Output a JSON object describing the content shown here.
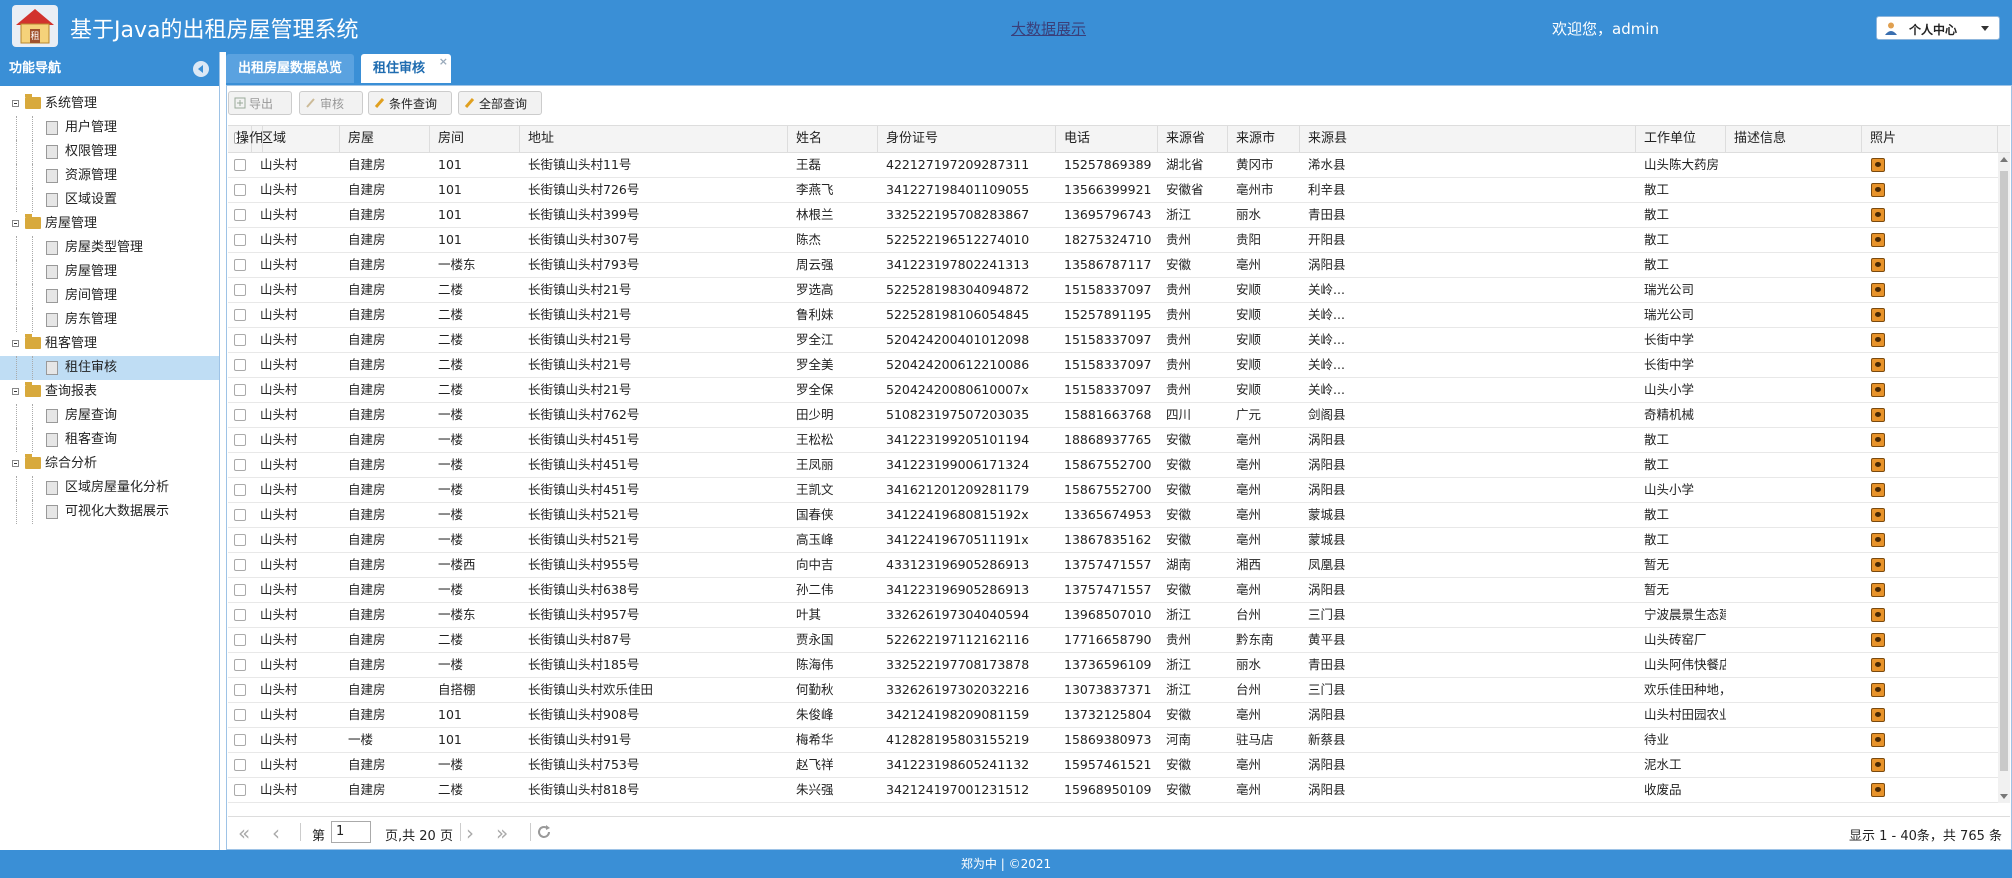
{
  "header": {
    "title": "基于Java的出租房屋管理系统",
    "big_data_link": "大数据展示",
    "welcome": "欢迎您，admin",
    "user_center": "个人中心"
  },
  "sidebar": {
    "title": "功能导航",
    "groups": [
      {
        "label": "系统管理",
        "items": [
          "用户管理",
          "权限管理",
          "资源管理",
          "区域设置"
        ]
      },
      {
        "label": "房屋管理",
        "items": [
          "房屋类型管理",
          "房屋管理",
          "房间管理",
          "房东管理"
        ]
      },
      {
        "label": "租客管理",
        "items": [
          "租住审核"
        ]
      },
      {
        "label": "查询报表",
        "items": [
          "房屋查询",
          "租客查询"
        ]
      },
      {
        "label": "综合分析",
        "items": [
          "区域房屋量化分析",
          "可视化大数据展示"
        ]
      }
    ],
    "selected": "租住审核"
  },
  "tabs": [
    {
      "label": "出租房屋数据总览"
    },
    {
      "label": "租住审核",
      "close": "×"
    }
  ],
  "toolbar": {
    "export": "导出",
    "audit": "审核",
    "condition_query": "条件查询",
    "all_query": "全部查询"
  },
  "table": {
    "columns": [
      "区域",
      "房屋",
      "房间",
      "地址",
      "姓名",
      "身份证号",
      "电话",
      "来源省",
      "来源市",
      "来源县",
      "工作单位",
      "描述信息",
      "照片",
      "操作"
    ],
    "rows": [
      [
        "山头村",
        "自建房",
        "101",
        "长街镇山头村11号",
        "王磊",
        "422127197209287311",
        "15257869389",
        "湖北省",
        "黄冈市",
        "浠水县",
        "山头陈大药房"
      ],
      [
        "山头村",
        "自建房",
        "101",
        "长街镇山头村726号",
        "李燕飞",
        "341227198401109055",
        "13566399921",
        "安徽省",
        "亳州市",
        "利辛县",
        "散工"
      ],
      [
        "山头村",
        "自建房",
        "101",
        "长街镇山头村399号",
        "林根兰",
        "332522195708283867",
        "13695796743",
        "浙江",
        "丽水",
        "青田县",
        "散工"
      ],
      [
        "山头村",
        "自建房",
        "101",
        "长街镇山头村307号",
        "陈杰",
        "522522196512274010",
        "18275324710",
        "贵州",
        "贵阳",
        "开阳县",
        "散工"
      ],
      [
        "山头村",
        "自建房",
        "一楼东",
        "长街镇山头村793号",
        "周云强",
        "341223197802241313",
        "13586787117",
        "安徽",
        "亳州",
        "涡阳县",
        "散工"
      ],
      [
        "山头村",
        "自建房",
        "二楼",
        "长街镇山头村21号",
        "罗选高",
        "522528198304094872",
        "15158337097",
        "贵州",
        "安顺",
        "关岭...",
        "瑞光公司"
      ],
      [
        "山头村",
        "自建房",
        "二楼",
        "长街镇山头村21号",
        "鲁利妹",
        "522528198106054845",
        "15257891195",
        "贵州",
        "安顺",
        "关岭...",
        "瑞光公司"
      ],
      [
        "山头村",
        "自建房",
        "二楼",
        "长街镇山头村21号",
        "罗全江",
        "520424200401012098",
        "15158337097",
        "贵州",
        "安顺",
        "关岭...",
        "长街中学"
      ],
      [
        "山头村",
        "自建房",
        "二楼",
        "长街镇山头村21号",
        "罗全美",
        "520424200612210086",
        "15158337097",
        "贵州",
        "安顺",
        "关岭...",
        "长街中学"
      ],
      [
        "山头村",
        "自建房",
        "二楼",
        "长街镇山头村21号",
        "罗全保",
        "52042420080610007x",
        "15158337097",
        "贵州",
        "安顺",
        "关岭...",
        "山头小学"
      ],
      [
        "山头村",
        "自建房",
        "一楼",
        "长街镇山头村762号",
        "田少明",
        "510823197507203035",
        "15881663768",
        "四川",
        "广元",
        "剑阁县",
        "奇精机械"
      ],
      [
        "山头村",
        "自建房",
        "一楼",
        "长街镇山头村451号",
        "王松松",
        "341223199205101194",
        "18868937765",
        "安徽",
        "亳州",
        "涡阳县",
        "散工"
      ],
      [
        "山头村",
        "自建房",
        "一楼",
        "长街镇山头村451号",
        "王凤丽",
        "341223199006171324",
        "15867552700",
        "安徽",
        "亳州",
        "涡阳县",
        "散工"
      ],
      [
        "山头村",
        "自建房",
        "一楼",
        "长街镇山头村451号",
        "王凯文",
        "341621201209281179",
        "15867552700",
        "安徽",
        "亳州",
        "涡阳县",
        "山头小学"
      ],
      [
        "山头村",
        "自建房",
        "一楼",
        "长街镇山头村521号",
        "国春侠",
        "34122419680815192x",
        "13365674953",
        "安徽",
        "亳州",
        "蒙城县",
        "散工"
      ],
      [
        "山头村",
        "自建房",
        "一楼",
        "长街镇山头村521号",
        "高玉峰",
        "34122419670511191x",
        "13867835162",
        "安徽",
        "亳州",
        "蒙城县",
        "散工"
      ],
      [
        "山头村",
        "自建房",
        "一楼西",
        "长街镇山头村955号",
        "向中吉",
        "433123196905286913",
        "13757471557",
        "湖南",
        "湘西",
        "凤凰县",
        "暂无"
      ],
      [
        "山头村",
        "自建房",
        "一楼",
        "长街镇山头村638号",
        "孙二伟",
        "341223196905286913",
        "13757471557",
        "安徽",
        "亳州",
        "涡阳县",
        "暂无"
      ],
      [
        "山头村",
        "自建房",
        "一楼东",
        "长街镇山头村957号",
        "叶其",
        "332626197304040594",
        "13968507010",
        "浙江",
        "台州",
        "三门县",
        "宁波晨景生态建设有限公司"
      ],
      [
        "山头村",
        "自建房",
        "二楼",
        "长街镇山头村87号",
        "贾永国",
        "522622197112162116",
        "17716658790",
        "贵州",
        "黔东南",
        "黄平县",
        "山头砖窑厂"
      ],
      [
        "山头村",
        "自建房",
        "一楼",
        "长街镇山头村185号",
        "陈海伟",
        "332522197708173878",
        "13736596109",
        "浙江",
        "丽水",
        "青田县",
        "山头阿伟快餐店"
      ],
      [
        "山头村",
        "自建房",
        "自搭棚",
        "长街镇山头村欢乐佳田",
        "何勤秋",
        "332626197302032216",
        "13073837371",
        "浙江",
        "台州",
        "三门县",
        "欢乐佳田种地，住棚里。"
      ],
      [
        "山头村",
        "自建房",
        "101",
        "长街镇山头村908号",
        "朱俊峰",
        "342124198209081159",
        "13732125804",
        "安徽",
        "亳州",
        "涡阳县",
        "山头村田园农业"
      ],
      [
        "山头村",
        "一楼",
        "101",
        "长街镇山头村91号",
        "梅希华",
        "412828195803155219",
        "15869380973",
        "河南",
        "驻马店",
        "新蔡县",
        "待业"
      ],
      [
        "山头村",
        "自建房",
        "一楼",
        "长街镇山头村753号",
        "赵飞祥",
        "341223198605241132",
        "15957461521",
        "安徽",
        "亳州",
        "涡阳县",
        "泥水工"
      ],
      [
        "山头村",
        "自建房",
        "二楼",
        "长街镇山头村818号",
        "朱兴强",
        "342124197001231512",
        "15968950109",
        "安徽",
        "亳州",
        "涡阳县",
        "收废品"
      ]
    ]
  },
  "pager": {
    "page_prefix": "第",
    "page_value": "1",
    "page_suffix": "页,共 20 页",
    "display_info": "显示 1 - 40条，共 765 条"
  },
  "footer": {
    "text": "郑为中 |   ©2021"
  }
}
